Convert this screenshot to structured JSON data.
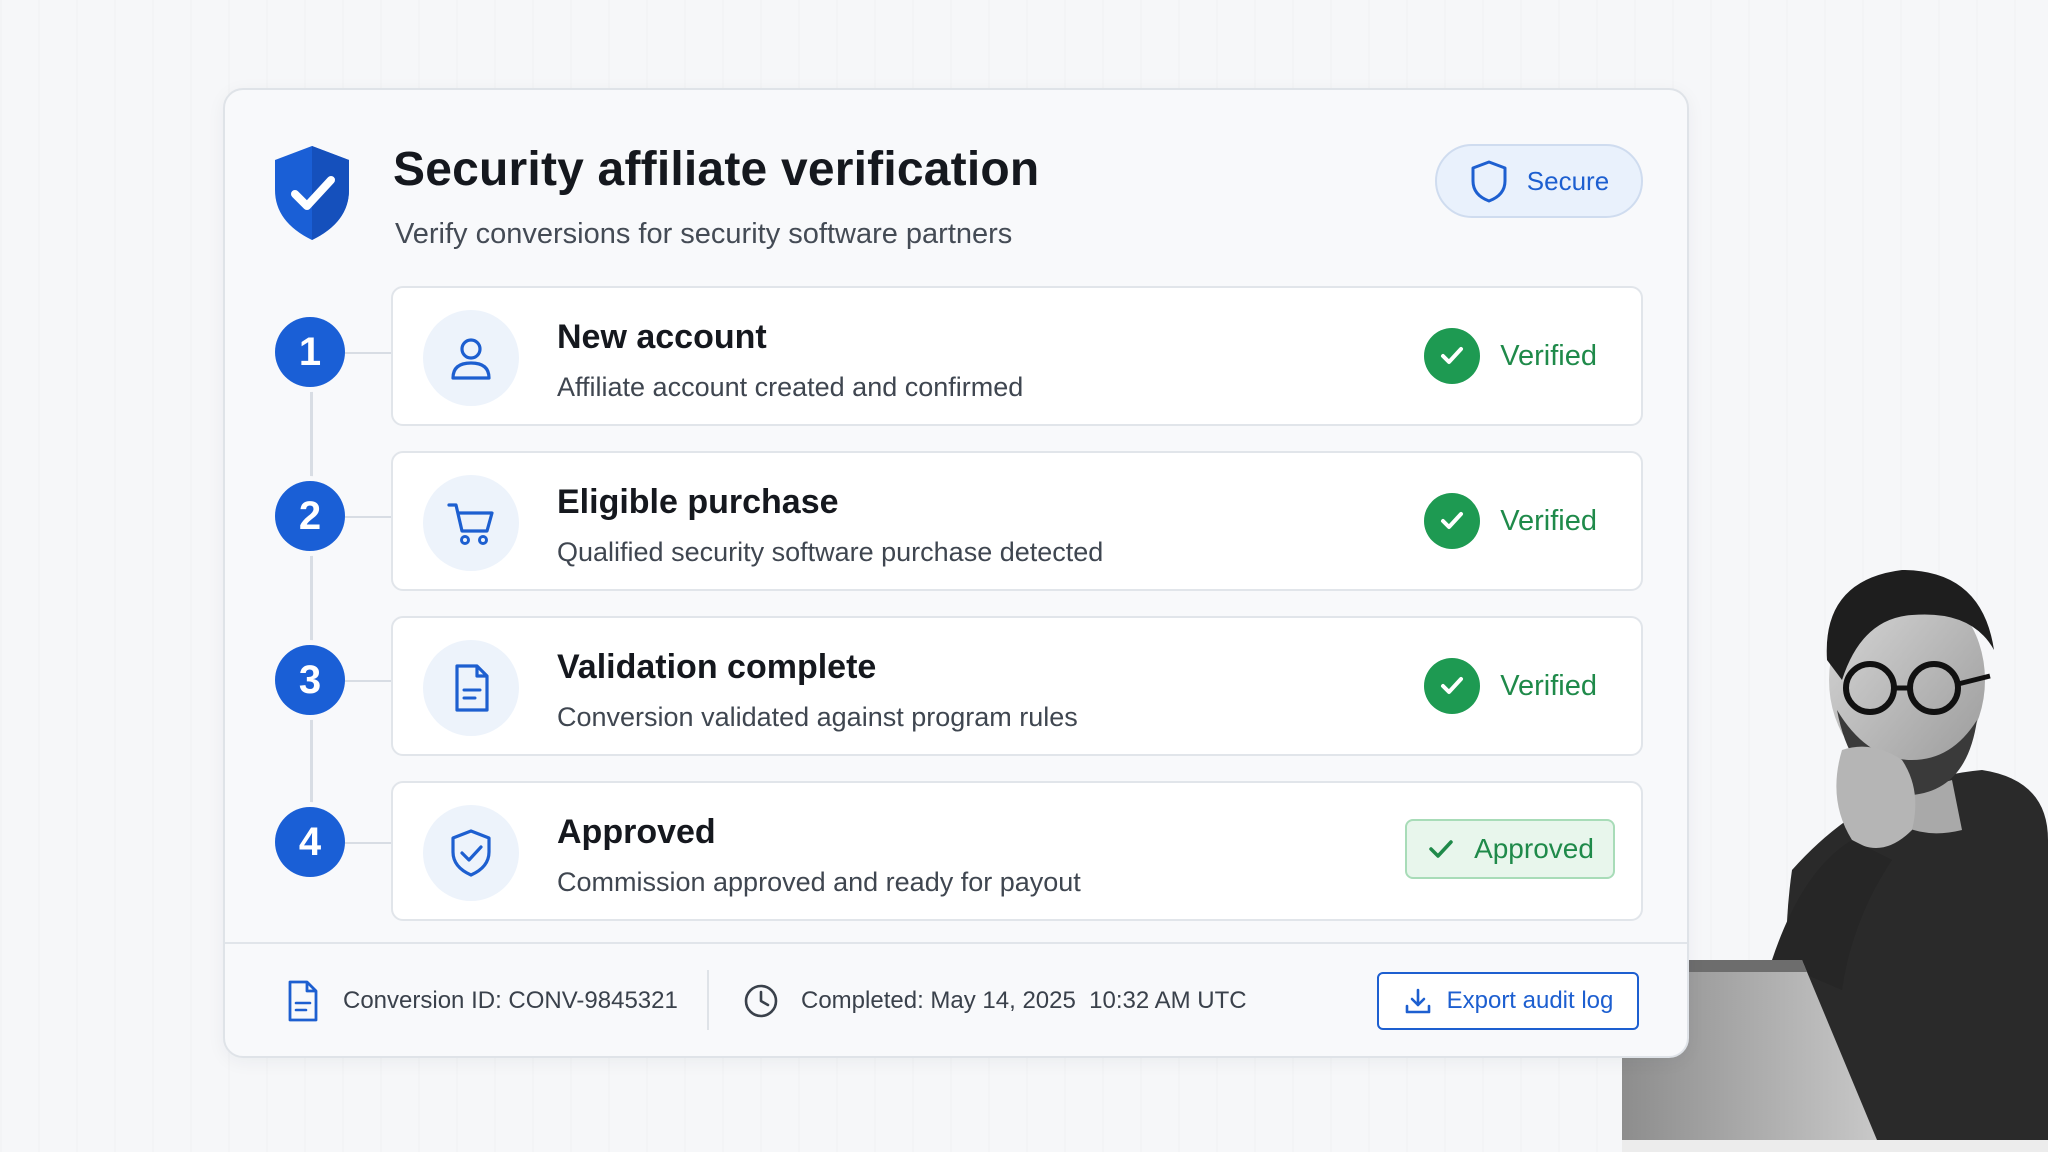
{
  "header": {
    "title": "Security affiliate verification",
    "subtitle": "Verify conversions for security software partners",
    "secure_label": "Secure"
  },
  "steps": [
    {
      "number": "1",
      "title": "New account",
      "description": "Affiliate account created and confirmed",
      "status": "Verified",
      "icon": "user-icon"
    },
    {
      "number": "2",
      "title": "Eligible purchase",
      "description": "Qualified security software purchase detected",
      "status": "Verified",
      "icon": "cart-icon"
    },
    {
      "number": "3",
      "title": "Validation complete",
      "description": "Conversion validated against program rules",
      "status": "Verified",
      "icon": "document-icon"
    },
    {
      "number": "4",
      "title": "Approved",
      "description": "Commission approved and ready for payout",
      "status": "Approved",
      "icon": "shield-check-icon"
    }
  ],
  "footer": {
    "conversion_id": "Conversion ID: CONV-9845321",
    "completed": "Completed: May 14, 2025  10:32 AM UTC",
    "export_label": "Export audit log"
  },
  "colors": {
    "accent": "#1a5fd6",
    "success": "#1e9a52",
    "background": "#f6f7f9"
  }
}
